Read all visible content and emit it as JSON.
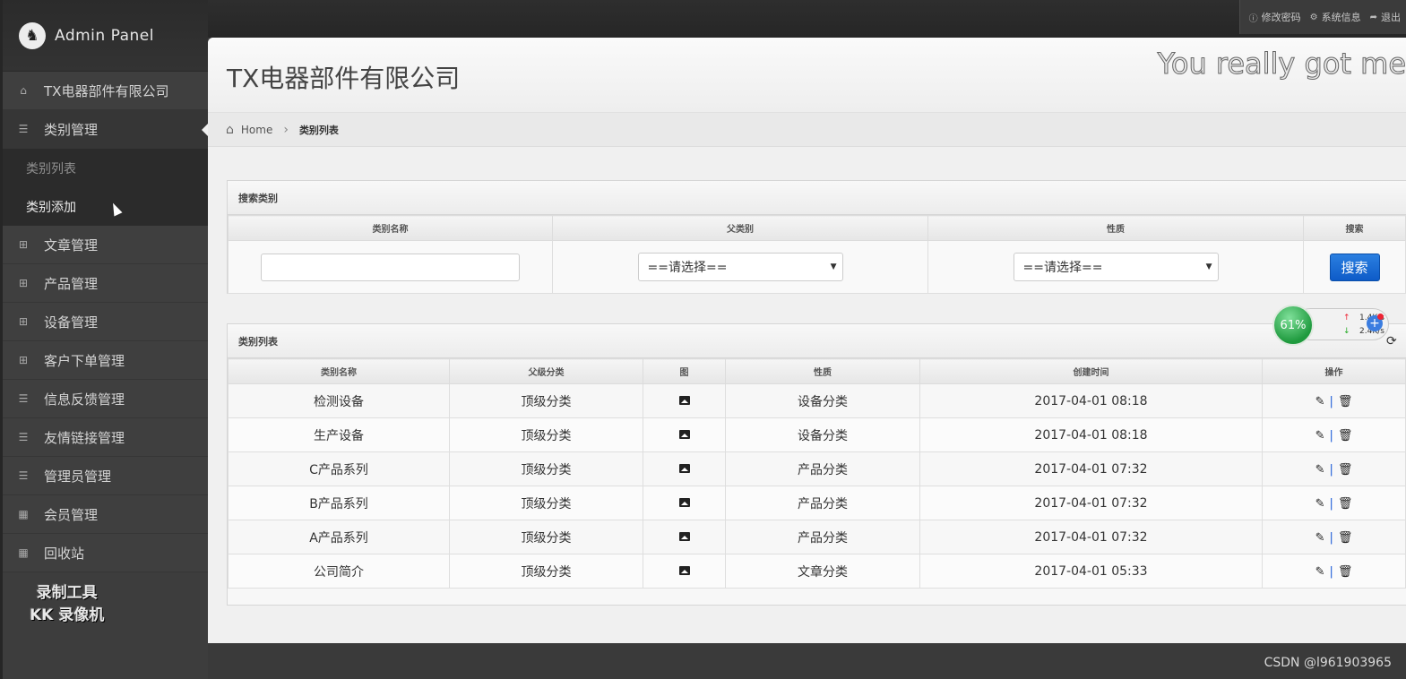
{
  "top_links": [
    {
      "label": "修改密码",
      "icon": "info-icon"
    },
    {
      "label": "系统信息",
      "icon": "gear-icon"
    },
    {
      "label": "退出",
      "icon": "logout-icon"
    }
  ],
  "brand": {
    "name": "Admin Panel"
  },
  "sidebar": {
    "items": [
      {
        "label": "TX电器部件有限公司",
        "icon": "home-icon"
      },
      {
        "label": "类别管理",
        "icon": "list-icon"
      },
      {
        "label": "文章管理",
        "icon": "grid-icon"
      },
      {
        "label": "产品管理",
        "icon": "grid-icon"
      },
      {
        "label": "设备管理",
        "icon": "grid-icon"
      },
      {
        "label": "客户下单管理",
        "icon": "grid-icon"
      },
      {
        "label": "信息反馈管理",
        "icon": "list-icon"
      },
      {
        "label": "友情链接管理",
        "icon": "list-icon"
      },
      {
        "label": "管理员管理",
        "icon": "list-icon"
      },
      {
        "label": "会员管理",
        "icon": "grid-icon"
      },
      {
        "label": "回收站",
        "icon": "grid-icon"
      }
    ],
    "sub_items": [
      {
        "label": "类别列表"
      },
      {
        "label": "类别添加"
      }
    ]
  },
  "recorder_watermark": {
    "line1": "录制工具",
    "line2": "KK 录像机"
  },
  "header": {
    "title": "TX电器部件有限公司",
    "marquee": "You really got me"
  },
  "breadcrumb": {
    "home": "Home",
    "current": "类别列表"
  },
  "search_panel": {
    "title": "搜索类别",
    "columns": [
      "类别名称",
      "父类别",
      "性质",
      "搜索"
    ],
    "name_value": "",
    "parent_select": "==请选择==",
    "nature_select": "==请选择==",
    "button": "搜索"
  },
  "list_panel": {
    "title": "类别列表",
    "columns": [
      "类别名称",
      "父级分类",
      "图",
      "性质",
      "创建时间",
      "操作"
    ],
    "rows": [
      {
        "name": "检测设备",
        "parent": "顶级分类",
        "nature": "设备分类",
        "created": "2017-04-01 08:18"
      },
      {
        "name": "生产设备",
        "parent": "顶级分类",
        "nature": "设备分类",
        "created": "2017-04-01 08:18"
      },
      {
        "name": "C产品系列",
        "parent": "顶级分类",
        "nature": "产品分类",
        "created": "2017-04-01 07:32"
      },
      {
        "name": "B产品系列",
        "parent": "顶级分类",
        "nature": "产品分类",
        "created": "2017-04-01 07:32"
      },
      {
        "name": "A产品系列",
        "parent": "顶级分类",
        "nature": "产品分类",
        "created": "2017-04-01 07:32"
      },
      {
        "name": "公司简介",
        "parent": "顶级分类",
        "nature": "文章分类",
        "created": "2017-04-01 05:33"
      }
    ],
    "action_sep": "|"
  },
  "net_widget": {
    "percent": "61%",
    "up": "1.4K/s",
    "down": "2.4K/s"
  },
  "footer_watermark": "CSDN @l961903965"
}
